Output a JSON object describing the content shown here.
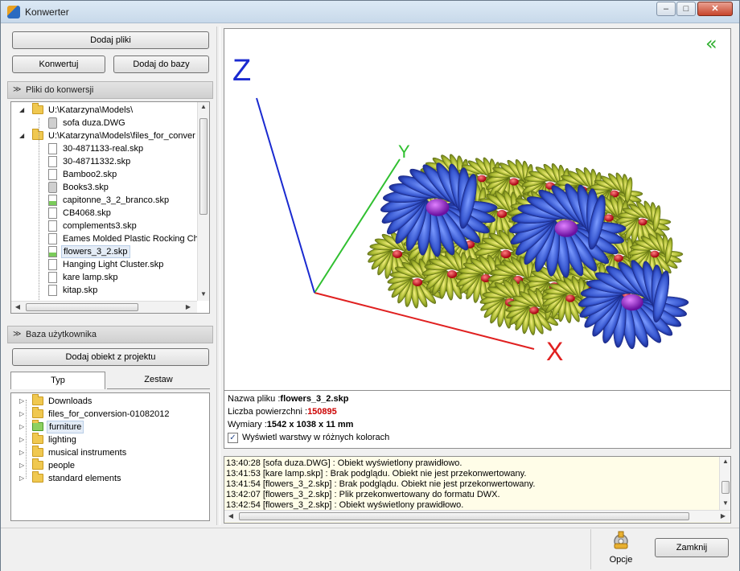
{
  "window": {
    "title": "Konwerter",
    "min": "–",
    "max": "□",
    "close": "✕"
  },
  "toolbar": {
    "add_files": "Dodaj pliki",
    "convert": "Konwertuj",
    "add_to_db": "Dodaj do bazy"
  },
  "files_section": {
    "title": "Pliki do konwersji",
    "items": [
      {
        "label": "U:\\Katarzyna\\Models\\",
        "level": 0,
        "type": "folder",
        "expander": "◢"
      },
      {
        "label": "sofa duza.DWG",
        "level": 1,
        "type": "gray"
      },
      {
        "label": "U:\\Katarzyna\\Models\\files_for_conver",
        "level": 0,
        "type": "folder",
        "expander": "◢"
      },
      {
        "label": "30-4871133-real.skp",
        "level": 1,
        "type": "file"
      },
      {
        "label": "30-48711332.skp",
        "level": 1,
        "type": "file"
      },
      {
        "label": "Bamboo2.skp",
        "level": 1,
        "type": "file"
      },
      {
        "label": "Books3.skp",
        "level": 1,
        "type": "gray"
      },
      {
        "label": "capitonne_3_2_branco.skp",
        "level": 1,
        "type": "green"
      },
      {
        "label": "CB4068.skp",
        "level": 1,
        "type": "file"
      },
      {
        "label": "complements3.skp",
        "level": 1,
        "type": "file"
      },
      {
        "label": "Eames Molded Plastic Rocking Chai",
        "level": 1,
        "type": "file"
      },
      {
        "label": "flowers_3_2.skp",
        "level": 1,
        "type": "green",
        "selected": true
      },
      {
        "label": "Hanging Light Cluster.skp",
        "level": 1,
        "type": "file"
      },
      {
        "label": "kare lamp.skp",
        "level": 1,
        "type": "file"
      },
      {
        "label": "kitap.skp",
        "level": 1,
        "type": "file"
      }
    ]
  },
  "user_db": {
    "title": "Baza użytkownika",
    "add_object": "Dodaj obiekt z projektu",
    "tabs": [
      "Typ",
      "Zestaw"
    ],
    "items": [
      {
        "label": "Downloads",
        "type": "folder"
      },
      {
        "label": "files_for_conversion-01082012",
        "type": "folder"
      },
      {
        "label": "furniture",
        "type": "folder-green",
        "selected": true
      },
      {
        "label": "lighting",
        "type": "folder"
      },
      {
        "label": "musical instruments",
        "type": "folder"
      },
      {
        "label": "people",
        "type": "folder"
      },
      {
        "label": "standard elements",
        "type": "folder"
      }
    ]
  },
  "viewer": {
    "axis_x": "X",
    "axis_y": "Y",
    "axis_z": "Z",
    "collapse": "«"
  },
  "info": {
    "file_label": "Nazwa pliku :",
    "file_value": "flowers_3_2.skp",
    "surfaces_label": "Liczba powierzchni :",
    "surfaces_value": "150895",
    "dims_label": "Wymiary :",
    "dims_value": "1542 x 1038 x 11 mm",
    "layers_label": "Wyświetl warstwy w różnych kolorach",
    "layers_checked": "✓"
  },
  "log": [
    "13:40:28 [sofa duza.DWG] : Obiekt wyświetlony prawidłowo.",
    "13:41:53 [kare lamp.skp] : Brak podglądu. Obiekt nie jest przekonwertowany.",
    "13:41:54 [flowers_3_2.skp] : Brak podglądu. Obiekt nie jest przekonwertowany.",
    "13:42:07 [flowers_3_2.skp] : Plik przekonwertowany do formatu DWX.",
    "13:42:54 [flowers_3_2.skp] : Obiekt wyświetlony prawidłowo."
  ],
  "footer": {
    "options": "Opcje",
    "close": "Zamknij"
  },
  "colors": {
    "accent_red": "#cc0000",
    "axis_x": "#e02020",
    "axis_y": "#30c030",
    "axis_z": "#1a2ad0"
  }
}
